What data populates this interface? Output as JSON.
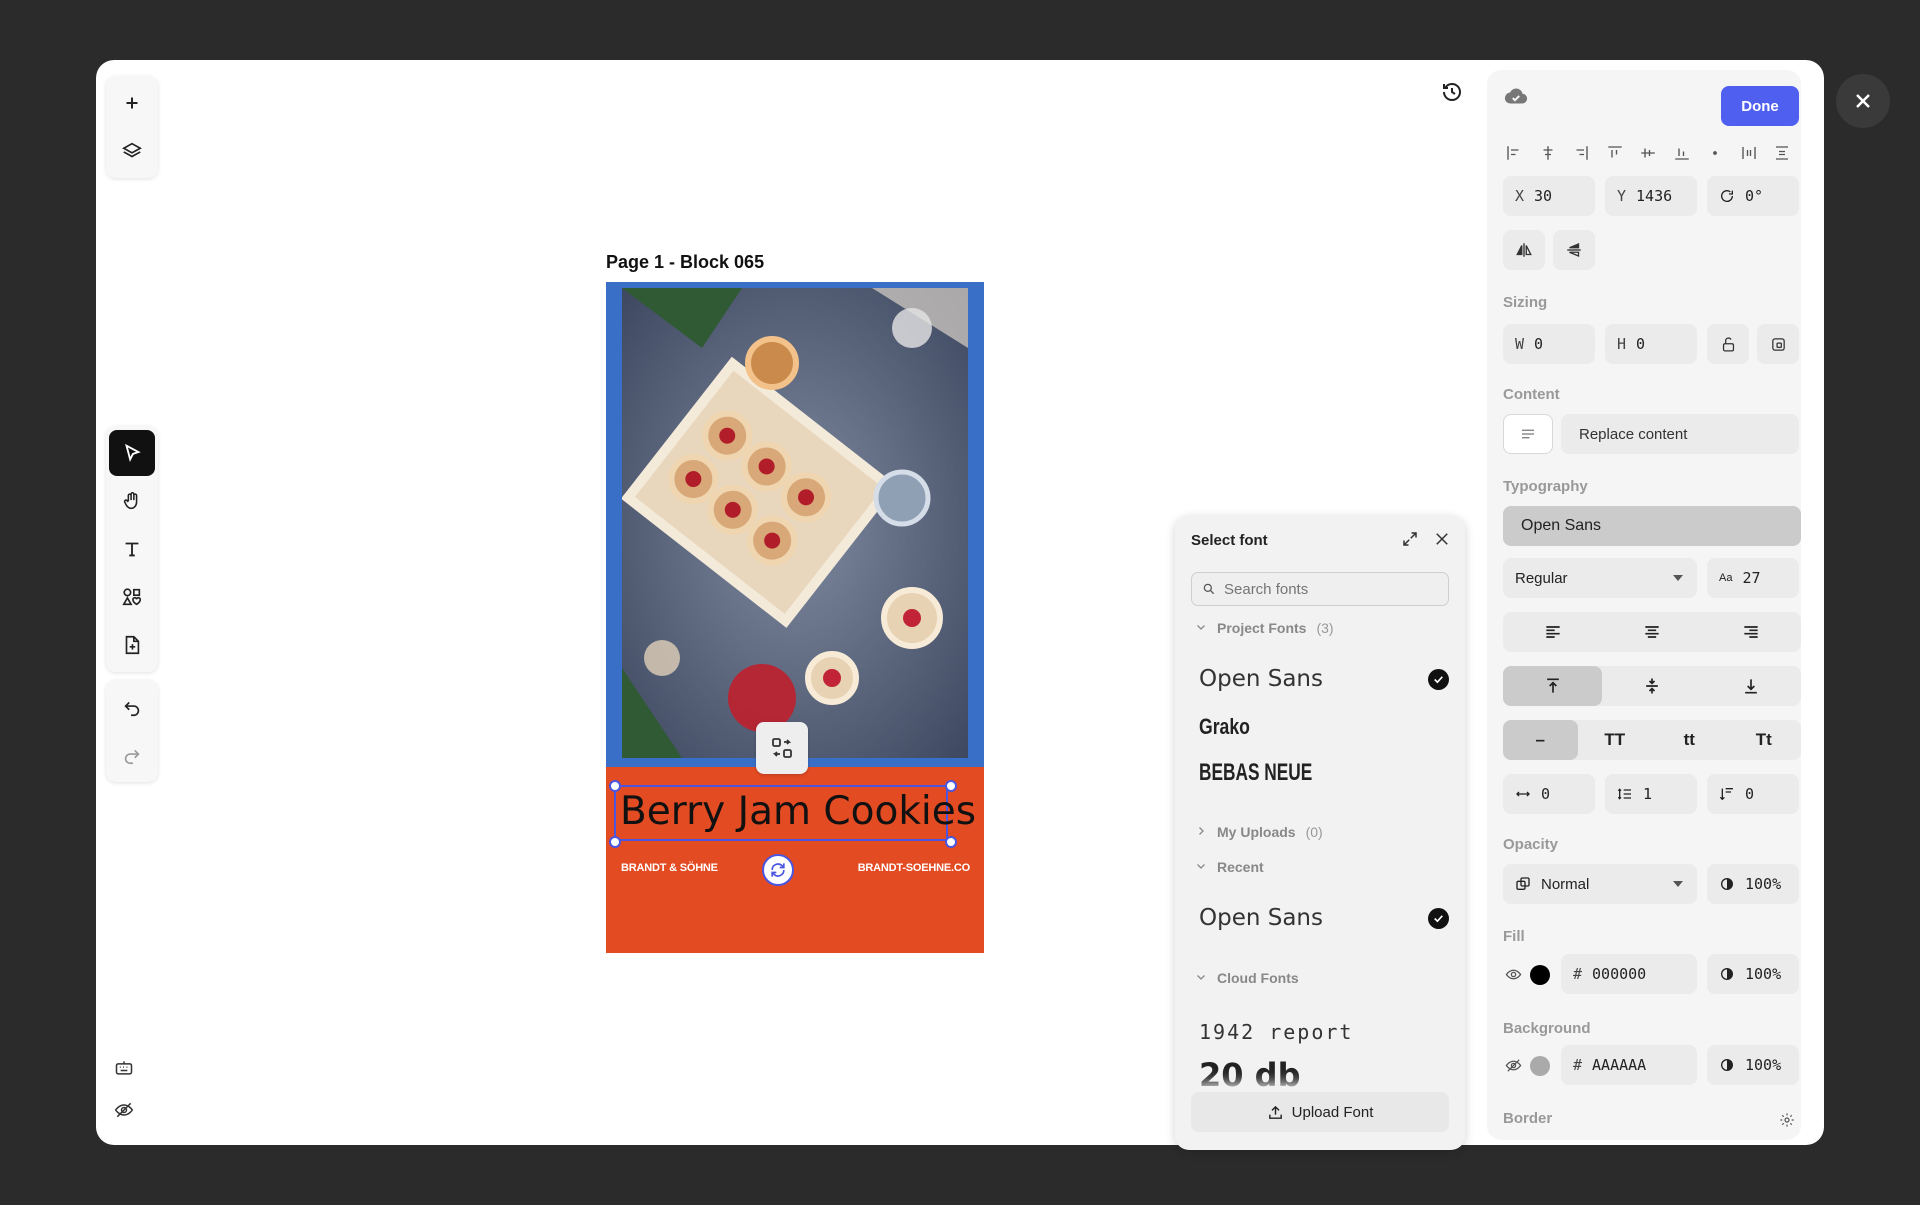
{
  "canvas": {
    "page_label": "Page 1 - Block 065",
    "title_text": "Berry Jam Cookies",
    "brand_left": "BRANDT & SÖHNE",
    "brand_right": "BRANDT-SOEHNE.CO",
    "artboard_color": "#e34b22",
    "frame_color": "#3a6fc7",
    "selection_color": "#4a55e0"
  },
  "toolbar": {
    "top": [
      "add-icon",
      "layers-icon"
    ],
    "tools": [
      "select-icon",
      "hand-icon",
      "text-icon",
      "elements-icon",
      "add-page-icon"
    ],
    "history": [
      "undo-icon",
      "redo-icon"
    ],
    "bottom": [
      "keyboard-icon",
      "hide-icon"
    ]
  },
  "font_panel": {
    "title": "Select font",
    "search_placeholder": "Search fonts",
    "sections": {
      "project": {
        "label": "Project Fonts",
        "count": "(3)"
      },
      "uploads": {
        "label": "My Uploads",
        "count": "(0)"
      },
      "recent": {
        "label": "Recent"
      },
      "cloud": {
        "label": "Cloud Fonts"
      }
    },
    "project_fonts": [
      "Open Sans",
      "Grako",
      "BEBAS NEUE"
    ],
    "recent_fonts": [
      "Open Sans"
    ],
    "cloud_fonts": [
      "1942 report",
      "20 db"
    ],
    "upload_label": "Upload Font"
  },
  "props": {
    "done_label": "Done",
    "x_label": "X",
    "x_value": "30",
    "y_label": "Y",
    "y_value": "1436",
    "rotation": "0°",
    "sizing_label": "Sizing",
    "w_label": "W",
    "w_value": "0",
    "h_label": "H",
    "h_value": "0",
    "content_label": "Content",
    "replace_content": "Replace content",
    "typography_label": "Typography",
    "font_family": "Open Sans",
    "font_weight": "Regular",
    "font_size": "27",
    "case_options": [
      "–",
      "TT",
      "tt",
      "Tt"
    ],
    "letter_spacing": "0",
    "line_height": "1",
    "paragraph_spacing": "0",
    "opacity_label": "Opacity",
    "blend_mode": "Normal",
    "opacity_value": "100%",
    "fill_label": "Fill",
    "fill_hex": "000000",
    "fill_opacity": "100%",
    "fill_color": "#000000",
    "background_label": "Background",
    "bg_hex": "AAAAAA",
    "bg_opacity": "100%",
    "bg_color": "#aaaaaa",
    "border_label": "Border",
    "accent_color": "#4f5ff0"
  }
}
